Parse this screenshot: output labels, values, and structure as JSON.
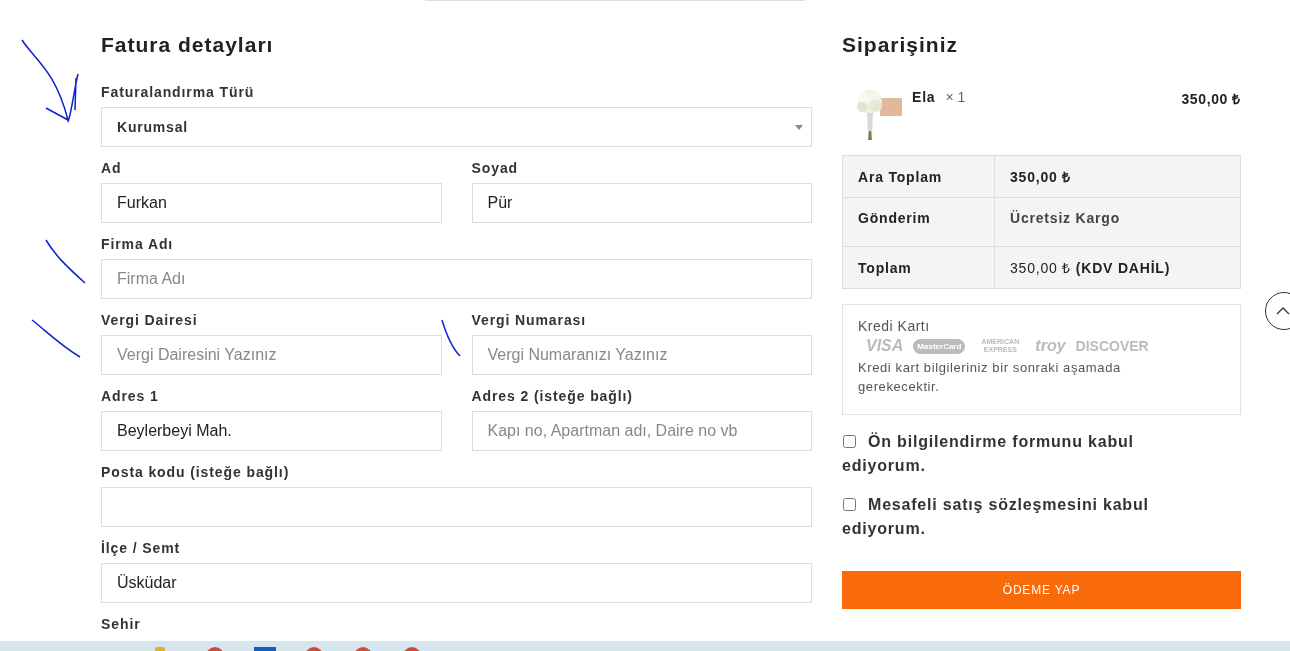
{
  "billing": {
    "title": "Fatura detayları",
    "rows": [
      [
        {
          "kind": "select",
          "label": "Faturalandırma Türü",
          "value": "Kurumsal"
        }
      ],
      [
        {
          "kind": "text",
          "label": "Ad",
          "value": "Furkan"
        },
        {
          "kind": "text",
          "label": "Soyad",
          "value": "Pür"
        }
      ],
      [
        {
          "kind": "text",
          "label": "Firma Adı",
          "placeholder": "Firma Adı"
        }
      ],
      [
        {
          "kind": "text",
          "label": "Vergi Dairesi",
          "placeholder": "Vergi Dairesini Yazınız"
        },
        {
          "kind": "text",
          "label": "Vergi Numarası",
          "placeholder": "Vergi Numaranızı Yazınız"
        }
      ],
      [
        {
          "kind": "text",
          "label": "Adres 1",
          "value": "Beylerbeyi Mah."
        },
        {
          "kind": "text",
          "label": "Adres 2 (isteğe bağlı)",
          "placeholder": "Kapı no, Apartman adı, Daire no vb"
        }
      ],
      [
        {
          "kind": "text",
          "label": "Posta kodu (isteğe bağlı)"
        }
      ],
      [
        {
          "kind": "text",
          "label": "İlçe / Semt",
          "value": "Üsküdar"
        }
      ],
      [
        {
          "kind": "label",
          "label": "Sehir"
        }
      ]
    ]
  },
  "order": {
    "title": "Siparişiniz",
    "product": {
      "name": "Ela",
      "quantity": "× 1",
      "price": "350,00 ₺"
    },
    "totals": [
      {
        "label": "Ara Toplam",
        "value": "350,00 ₺"
      },
      {
        "label": "Gönderim",
        "value": "Ücretsiz Kargo"
      },
      {
        "label": "Toplam",
        "value": "350,00 ₺ **(KDV DAHİL)**"
      }
    ],
    "payment": {
      "title": "Kredi Kartı",
      "brands": [
        "VISA",
        "MasterCard",
        "AMERICAN EXPRESS",
        "troy",
        "DISCOVER"
      ],
      "note": "Kredi kart bilgileriniz bir sonraki aşamada gerekecektir."
    },
    "agreements": [
      {
        "label": "Ön bilgilendirme formunu kabul ediyorum.",
        "checked": false
      },
      {
        "label": "Mesafeli satış sözleşmesini kabul ediyorum.",
        "checked": false
      }
    ],
    "submit": "ÖDEME YAP"
  }
}
